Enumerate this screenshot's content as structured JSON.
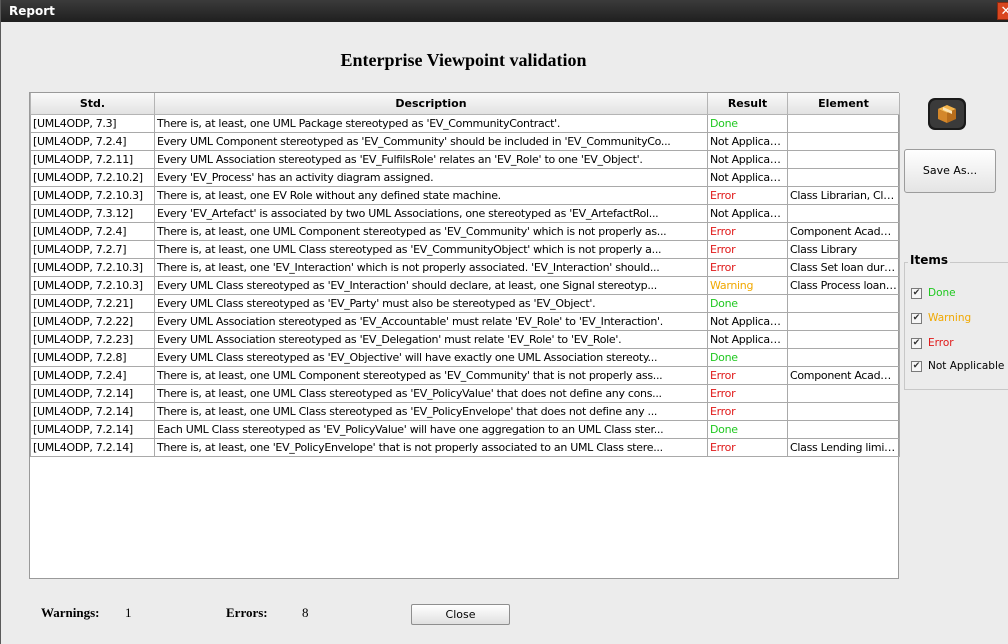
{
  "window": {
    "title": "Report",
    "close_glyph": "✕"
  },
  "heading": "Enterprise Viewpoint validation",
  "table": {
    "columns": [
      "Std.",
      "Description",
      "Result",
      "Element"
    ],
    "rows": [
      {
        "std": "[UML4ODP, 7.3]",
        "desc": "There is, at least, one UML Package stereotyped as 'EV_CommunityContract'.",
        "result": "Done",
        "element": ""
      },
      {
        "std": "[UML4ODP, 7.2.4]",
        "desc": "Every UML Component stereotyped as 'EV_Community' should be included in 'EV_CommunityCo...",
        "result": "Not Applicable",
        "element": ""
      },
      {
        "std": "[UML4ODP, 7.2.11]",
        "desc": "Every UML Association stereotyped as 'EV_FulfilsRole' relates an 'EV_Role' to one 'EV_Object'.",
        "result": "Not Applicable",
        "element": ""
      },
      {
        "std": "[UML4ODP, 7.2.10.2]",
        "desc": "Every 'EV_Process' has an activity diagram assigned.",
        "result": "Not Applicable",
        "element": ""
      },
      {
        "std": "[UML4ODP, 7.2.10.3]",
        "desc": "There is, at least, one EV Role without any defined state machine.",
        "result": "Error",
        "element": "Class Librarian, Class ..."
      },
      {
        "std": "[UML4ODP, 7.3.12]",
        "desc": "Every 'EV_Artefact' is associated by two UML Associations, one stereotyped as 'EV_ArtefactRol...",
        "result": "Not Applicable",
        "element": ""
      },
      {
        "std": "[UML4ODP, 7.2.4]",
        "desc": "There is, at least, one UML Component stereotyped as 'EV_Community' which is not properly as...",
        "result": "Error",
        "element": "Component Academic ..."
      },
      {
        "std": "[UML4ODP, 7.2.7]",
        "desc": "There is, at least, one UML Class stereotyped as 'EV_CommunityObject' which is not properly a...",
        "result": "Error",
        "element": "Class Library"
      },
      {
        "std": "[UML4ODP, 7.2.10.3]",
        "desc": "There is, at least, one 'EV_Interaction' which is not properly associated. 'EV_Interaction' should...",
        "result": "Error",
        "element": "Class Set loan duratio..."
      },
      {
        "std": "[UML4ODP, 7.2.10.3]",
        "desc": "Every UML Class stereotyped as 'EV_Interaction' should declare, at least, one Signal stereotyp...",
        "result": "Warning",
        "element": "Class Process loan, Cl..."
      },
      {
        "std": "[UML4ODP, 7.2.21]",
        "desc": "Every UML Class stereotyped as 'EV_Party' must also be stereotyped as 'EV_Object'.",
        "result": "Done",
        "element": ""
      },
      {
        "std": "[UML4ODP, 7.2.22]",
        "desc": "Every UML Association stereotyped as 'EV_Accountable' must relate  'EV_Role' to 'EV_Interaction'.",
        "result": "Not Applicable",
        "element": ""
      },
      {
        "std": "[UML4ODP, 7.2.23]",
        "desc": "Every UML Association stereotyped as 'EV_Delegation' must relate 'EV_Role' to 'EV_Role'.",
        "result": "Not Applicable",
        "element": ""
      },
      {
        "std": "[UML4ODP, 7.2.8]",
        "desc": "Every UML Class stereotyped as 'EV_Objective' will have exactly one UML Association stereoty...",
        "result": "Done",
        "element": ""
      },
      {
        "std": "[UML4ODP, 7.2.4]",
        "desc": "There is, at least, one UML Component stereotyped as 'EV_Community' that is not properly ass...",
        "result": "Error",
        "element": "Component Academic ..."
      },
      {
        "std": "[UML4ODP, 7.2.14]",
        "desc": "There is, at least, one UML Class stereotyped as 'EV_PolicyValue' that does not define any cons...",
        "result": "Error",
        "element": ""
      },
      {
        "std": "[UML4ODP, 7.2.14]",
        "desc": "There is, at least, one UML Class stereotyped as 'EV_PolicyEnvelope' that does not define any ...",
        "result": "Error",
        "element": ""
      },
      {
        "std": "[UML4ODP, 7.2.14]",
        "desc": "Each UML Class stereotyped as 'EV_PolicyValue' will have one aggregation to an UML Class ster...",
        "result": "Done",
        "element": ""
      },
      {
        "std": "[UML4ODP, 7.2.14]",
        "desc": "There is, at least, one 'EV_PolicyEnvelope' that is not properly associated to an UML Class stere...",
        "result": "Error",
        "element": "Class Lending limit, Cla..."
      }
    ]
  },
  "result_colors": {
    "Done": "#1fc81f",
    "Warning": "#f0a800",
    "Error": "#e01818",
    "Not Applicable": "#000000"
  },
  "sidebar": {
    "icon": "package-icon",
    "save_label": "Save As...",
    "items_legend": "Items",
    "filters": [
      {
        "label": "Done",
        "checked": true,
        "color": "#1fc81f"
      },
      {
        "label": "Warning",
        "checked": true,
        "color": "#f0a800"
      },
      {
        "label": "Error",
        "checked": true,
        "color": "#e01818"
      },
      {
        "label": "Not Applicable",
        "checked": true,
        "color": "#000000"
      }
    ]
  },
  "footer": {
    "warnings_label": "Warnings:",
    "warnings_value": "1",
    "errors_label": "Errors:",
    "errors_value": "8",
    "close_label": "Close"
  }
}
